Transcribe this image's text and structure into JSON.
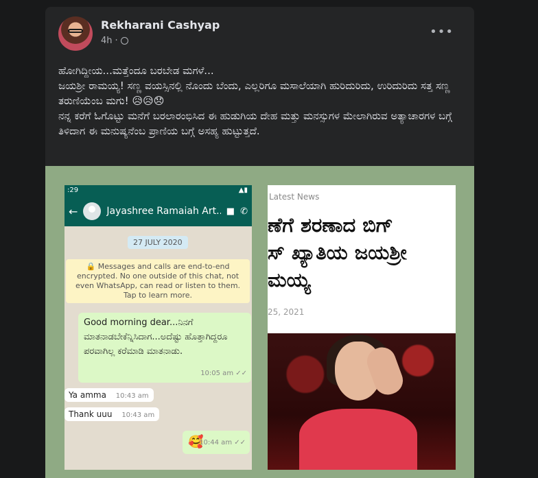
{
  "post": {
    "author": "Rekharani Cashyap",
    "time": "4h",
    "more_label": "•••",
    "lines": [
      "ಹೋಗಿದ್ದೀಯ...ಮತ್ತೆಂದೂ ಬರಬೇಡ ಮಗಳೆ...",
      "ಜಯಶ್ರೀ ರಾಮಯ್ಯ! ಸಣ್ಣ ವಯಸ್ಸಿನಲ್ಲಿ ನೊಂದು ಬೆಂದು, ಎಲ್ಲರಿಗೂ ಮಸಾಲೆಯಾಗಿ ಹುರಿದುರಿದು, ಉರಿದುರಿದು ಸತ್ತ ಸಣ್ಣ ತರುಣಿಯೆಂಬ ಮಗು! 😥😥😞",
      "ನನ್ನ ಕರೆಗೆ ಓಗೊಟ್ಟು ಮನೆಗೆ ಬರಲಾರಂಭಿಸಿದ ಈ ಹುಡುಗಿಯ ದೇಹ ಮತ್ತು ಮನಸ್ಸುಗಳ ಮೇಲಾಗಿರುವ ಅತ್ಯಾಚಾರಗಳ ಬಗ್ಗೆ ತಿಳಿದಾಗ ಈ ಮನುಷ್ಯನೆಂಬ ಪ್ರಾಣಿಯ ಬಗ್ಗೆ ಅಸಹ್ಯ ಹುಟ್ಟುತ್ತದೆ."
    ]
  },
  "whatsapp": {
    "status_time": ":29",
    "contact": "Jayashree Ramaiah Art...",
    "date": "27 JULY 2020",
    "encryption": "🔒 Messages and calls are end-to-end encrypted. No one outside of this chat, not even WhatsApp, can read or listen to them. Tap to learn more.",
    "msg1": "Good morning dear...ನಿನಗೆ ಮಾತನಾಡಬೇಕೆನ್ನಿಸಿದಾಗ...ಅದೆಷ್ಟು ಹೊತ್ತಾಗಿದ್ದರೂ ಪರವಾಗಿಲ್ಲ ಕರೆಮಾಡಿ ಮಾತನಾಡು.",
    "msg1_time": "10:05 am ✓✓",
    "msg2": "Ya amma",
    "msg2_time": "10:43 am",
    "msg3": "Thank uuu",
    "msg3_time": "10:43 am",
    "msg4": "🥰",
    "msg4_time": "10:44 am ✓✓"
  },
  "news": {
    "label": "Latest News",
    "headline_line1": "ಣೆಗೆ ಶರಣಾದ ಬಿಗ್",
    "headline_line2": "ಸ್ ಖ್ಯಾತಿಯ ಜಯಶ್ರೀ",
    "headline_line3": "ಮಯ್ಯ",
    "date": "25, 2021"
  }
}
